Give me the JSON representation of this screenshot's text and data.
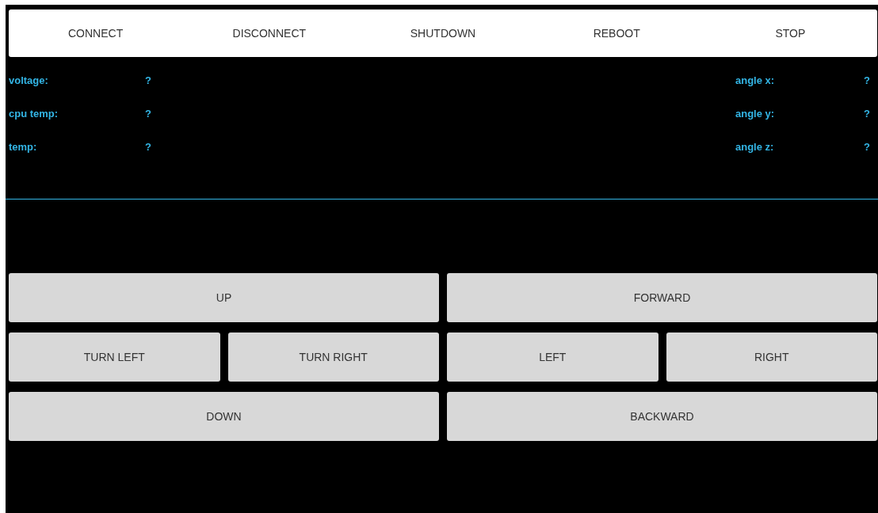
{
  "toolbar": [
    "CONNECT",
    "DISCONNECT",
    "SHUTDOWN",
    "REBOOT",
    "STOP"
  ],
  "status_left": [
    {
      "label": "voltage:",
      "value": "?"
    },
    {
      "label": "cpu temp:",
      "value": "?"
    },
    {
      "label": "temp:",
      "value": "?"
    }
  ],
  "status_right": [
    {
      "label": "angle x:",
      "value": "?"
    },
    {
      "label": "angle y:",
      "value": "?"
    },
    {
      "label": "angle z:",
      "value": "?"
    }
  ],
  "controls": [
    [
      "UP",
      "FORWARD"
    ],
    [
      "TURN LEFT",
      "TURN RIGHT",
      "LEFT",
      "RIGHT"
    ],
    [
      "DOWN",
      "BACKWARD"
    ]
  ]
}
